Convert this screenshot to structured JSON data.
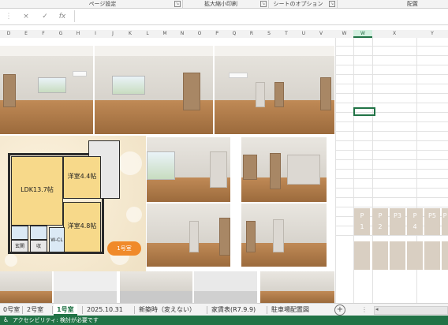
{
  "ribbon": {
    "groups": [
      "ページ設定",
      "拡大縮小印刷",
      "シートのオプション",
      "配置"
    ]
  },
  "formula_bar": {
    "cancel_icon": "×",
    "enter_icon": "✓",
    "function_icon": "fx",
    "value": ""
  },
  "columns": [
    "D",
    "E",
    "F",
    "G",
    "H",
    "I",
    "J",
    "K",
    "L",
    "M",
    "N",
    "O",
    "P",
    "Q",
    "R",
    "S",
    "T",
    "U",
    "V",
    "W",
    "X",
    "Y"
  ],
  "selected_column": "W",
  "floor_plan": {
    "rooms": [
      "LDK13.7帖",
      "洋室4.4帖",
      "洋室4.8帖",
      "W-CL",
      "玄関",
      "収"
    ],
    "unit_badge": "1号室"
  },
  "page_markers": [
    {
      "prefix": "P",
      "num": "1"
    },
    {
      "prefix": "P",
      "num": "2"
    },
    {
      "prefix": "P3",
      "num": ""
    },
    {
      "prefix": "P",
      "num": "4"
    },
    {
      "prefix": "P5",
      "num": ""
    },
    {
      "prefix": "P",
      "num": ""
    }
  ],
  "sheet_tabs": [
    {
      "label": "0号室",
      "active": false
    },
    {
      "label": "2号室",
      "active": false
    },
    {
      "label": "1号室",
      "active": true
    },
    {
      "label": "2025.10.31",
      "active": false
    },
    {
      "label": "新築時（変えない）",
      "active": false
    },
    {
      "label": "家賃表(R7.9.9)",
      "active": false
    },
    {
      "label": "駐車場配置図",
      "active": false
    }
  ],
  "add_sheet_icon": "+",
  "status_bar": {
    "accessibility_icon": "accessibility-icon",
    "text": "アクセシビリティ: 検討が必要です"
  },
  "colors": {
    "accent": "#217346",
    "badge": "#f08a2a",
    "room_fill": "#f7d98a"
  }
}
